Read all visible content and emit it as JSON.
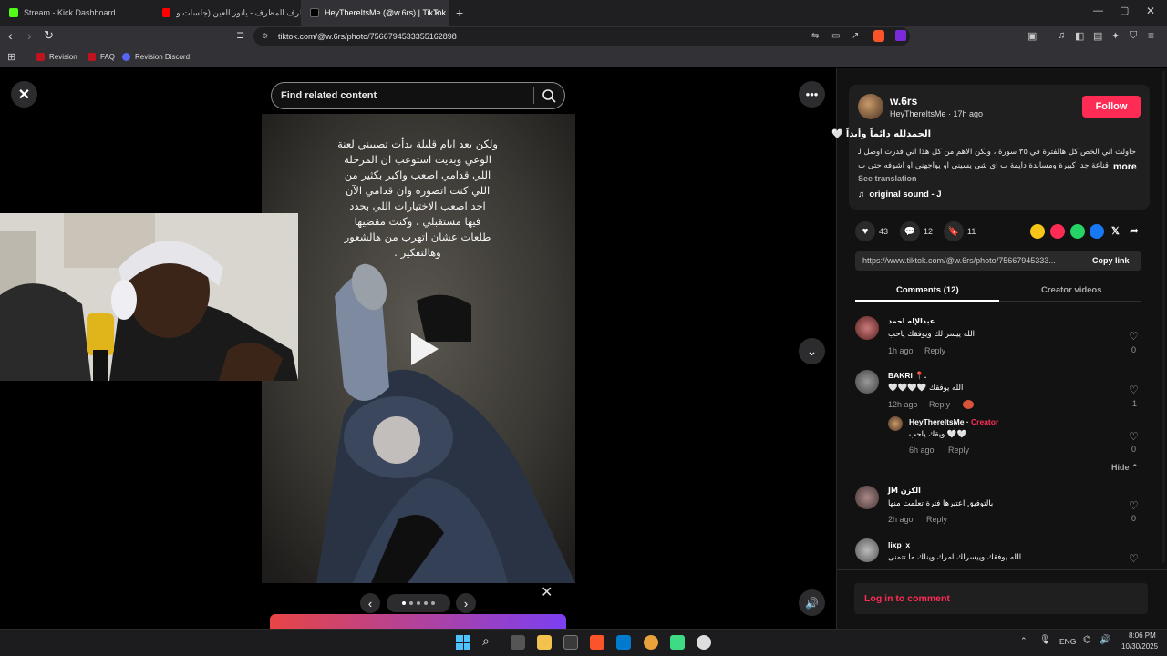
{
  "browser": {
    "tabs": [
      {
        "title": "Stream - Kick Dashboard",
        "active": false
      },
      {
        "title": "مظرف المظرف - يانور العين (جلسات و",
        "active": false
      },
      {
        "title": "HeyThereItsMe (@w.6rs) | TikTok",
        "active": true
      }
    ],
    "url": "tiktok.com/@w.6rs/photo/7566794533355162898",
    "bookmarks": [
      "Revision",
      "FAQ",
      "Revision Discord"
    ]
  },
  "viewer": {
    "search_placeholder": "Find related content",
    "overlay_text": "ولكن بعد ايام قليلة بدأت تصيبني لعنة\nالوعي وبديت استوعب ان المرحلة\nاللي قدامي اصعب واكبر بكثير من\nاللي كنت اتصوره وان قدامي الآن\nاحد اصعب الاختيارات اللي بحدد\nفيها مستقبلي ، وكنت مقضيها\nطلعات عشان اتهرب من هالشعور\nوهالتفكير ."
  },
  "post": {
    "username": "w.6rs",
    "display_name": "HeyThereItsMe",
    "time": "17h ago",
    "follow_label": "Follow",
    "title": "الحمدلله دائماً وأبداً 🤍",
    "desc_line1": "حاولت اني الخص كل هالفترة في ٣٥ سورة ، ولكن الأهم من كل هذا اني قدرت اوصل لـ",
    "desc_line2": "قناعة جداً كبيرة ومساندة دايمة ب اي شي يسيني او يواجهني او اشوفه حتى ب...",
    "more_label": "more",
    "see_translation": "See translation",
    "sound": "original sound - J",
    "likes": "43",
    "comments_count": "12",
    "saves": "11",
    "link": "https://www.tiktok.com/@w.6rs/photo/75667945333...",
    "copy_link": "Copy link",
    "tab_comments": "Comments (12)",
    "tab_creator": "Creator videos"
  },
  "comments": [
    {
      "user": "عبدالإله احمد",
      "text": "الله ييسر لك ويوفقك ياحب",
      "time": "1h ago",
      "reply": "Reply",
      "likes": "0"
    },
    {
      "user": "BAKRi 📍.",
      "text": "🤍🤍🤍🤍 الله يوفقك",
      "time": "12h ago",
      "reply": "Reply",
      "likes": "1"
    },
    {
      "user": "HeyThereItsMe",
      "creator_tag": "Creator",
      "text": "ويقك ياحب 🤍🤍",
      "time": "6h ago",
      "reply": "Reply",
      "likes": "0"
    },
    {
      "user": "الكزن JM",
      "text": "بالتوفيق اعتبرها فترة تعلمت منها",
      "time": "2h ago",
      "reply": "Reply",
      "likes": "0"
    },
    {
      "user": "lixp_x",
      "text": "الله يوفقك وييسرلك امرك وينلك ما تتمنى",
      "time": "",
      "reply": "",
      "likes": ""
    }
  ],
  "hide_label": "Hide",
  "login_label": "Log in to comment",
  "taskbar": {
    "lang": "ENG",
    "time": "8:06 PM",
    "date": "10/30/2025"
  },
  "colors": {
    "accent": "#fe2c55",
    "panel": "#121212",
    "card": "#1f1f1f"
  }
}
